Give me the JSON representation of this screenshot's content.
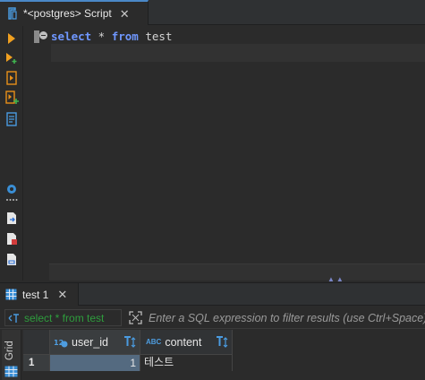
{
  "editor_tab": {
    "title": "*<postgres> Script",
    "close": "✕"
  },
  "editor": {
    "keyword_select": "select",
    "star": " * ",
    "keyword_from": "from",
    "table": " test"
  },
  "results_tab": {
    "title": "test 1",
    "close": "✕"
  },
  "filter": {
    "query_text": "select * from test",
    "placeholder": "Enter a SQL expression to filter results (use Ctrl+Space)"
  },
  "grid": {
    "side_label": "Grid",
    "columns": [
      {
        "type_badge": "123",
        "label": "user_id"
      },
      {
        "type_badge": "ABC",
        "label": "content"
      }
    ],
    "rows": [
      {
        "num": "1",
        "user_id": "1",
        "content": "테스트"
      }
    ]
  },
  "colors": {
    "keyword": "#6f97ff",
    "filter_query": "#2e9d3d",
    "selected_cell": "#546a80",
    "active_tab_accent": "#4a88c7"
  }
}
